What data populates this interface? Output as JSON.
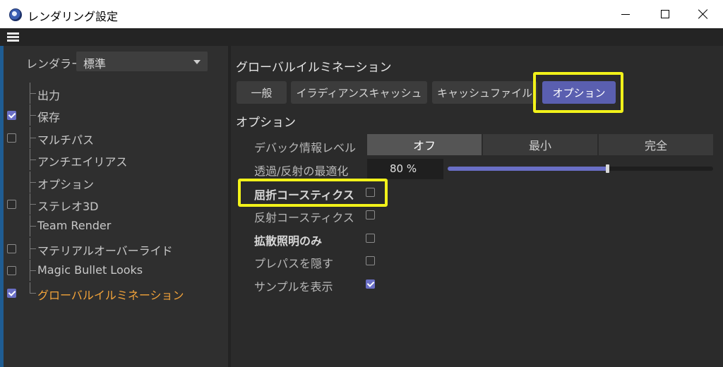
{
  "window": {
    "title": "レンダリング設定",
    "icons": {
      "app": "cinema4d-app-icon",
      "minimize": "minimize-icon",
      "maximize": "maximize-icon",
      "close": "close-icon"
    }
  },
  "menubar": {
    "menu_icon": "hamburger-menu-icon"
  },
  "sidebar": {
    "renderer_label": "レンダラー",
    "renderer_value": "標準",
    "items": [
      {
        "label": "出力",
        "checkbox": false,
        "checked": false,
        "active": false
      },
      {
        "label": "保存",
        "checkbox": true,
        "checked": true,
        "active": false
      },
      {
        "label": "マルチパス",
        "checkbox": true,
        "checked": false,
        "active": false
      },
      {
        "label": "アンチエイリアス",
        "checkbox": false,
        "checked": false,
        "active": false
      },
      {
        "label": "オプション",
        "checkbox": false,
        "checked": false,
        "active": false
      },
      {
        "label": "ステレオ3D",
        "checkbox": true,
        "checked": false,
        "active": false
      },
      {
        "label": "Team Render",
        "checkbox": false,
        "checked": false,
        "active": false
      },
      {
        "label": "マテリアルオーバーライド",
        "checkbox": true,
        "checked": false,
        "active": false
      },
      {
        "label": "Magic Bullet Looks",
        "checkbox": true,
        "checked": false,
        "active": false
      },
      {
        "label": "グローバルイルミネーション",
        "checkbox": true,
        "checked": true,
        "active": true
      }
    ]
  },
  "main": {
    "section_title": "グローバルイルミネーション",
    "tabs": [
      {
        "label": "一般",
        "active": false
      },
      {
        "label": "イラディアンスキャッシュ",
        "active": false
      },
      {
        "label": "キャッシュファイル",
        "active": false
      },
      {
        "label": "オプション",
        "active": true
      }
    ],
    "options_heading": "オプション",
    "debug_level": {
      "label": "デバック情報レベル",
      "options": [
        "オフ",
        "最小",
        "完全"
      ],
      "selected": "オフ"
    },
    "optimization": {
      "label": "透過/反射の最適化",
      "value": "80 %",
      "fraction": 0.6
    },
    "checkboxes": [
      {
        "label": "屈折コースティクス",
        "checked": false,
        "bold": true
      },
      {
        "label": "反射コースティクス",
        "checked": false,
        "bold": false
      },
      {
        "label": "拡散照明のみ",
        "checked": false,
        "bold": true
      },
      {
        "label": "プレパスを隠す",
        "checked": false,
        "bold": false
      },
      {
        "label": "サンプルを表示",
        "checked": true,
        "bold": false
      }
    ]
  },
  "colors": {
    "accent": "#6a6fc6",
    "active_tab": "#5a5fb0",
    "active_item": "#f2a33a",
    "highlight": "#f2f21a"
  }
}
